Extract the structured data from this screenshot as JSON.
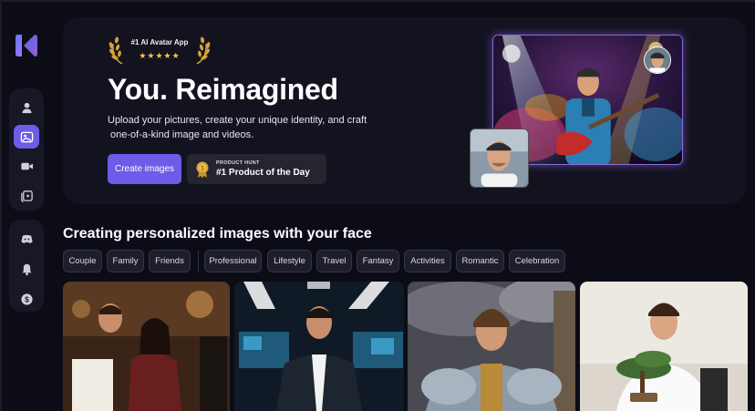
{
  "sidebar": {
    "logo": "app-logo",
    "group1": [
      {
        "icon": "user-icon",
        "active": false
      },
      {
        "icon": "face-image-icon",
        "active": true
      },
      {
        "icon": "video-camera-icon",
        "active": false
      },
      {
        "icon": "video-library-icon",
        "active": false
      }
    ],
    "group2": [
      {
        "icon": "discord-icon"
      },
      {
        "icon": "bell-icon"
      },
      {
        "icon": "dollar-icon"
      }
    ]
  },
  "hero": {
    "award_title": "#1 AI Avatar App",
    "award_stars": "★★★★★",
    "title": "You. Reimagined",
    "subtitle_line1": "Upload your pictures, create your unique identity, and craft",
    "subtitle_line2": "one-of-a-kind image and videos.",
    "cta_label": "Create images",
    "product_hunt_small": "PRODUCT HUNT",
    "product_hunt_main": "#1 Product of the Day"
  },
  "section": {
    "title": "Creating personalized images with your face",
    "chips": [
      "Couple",
      "Family",
      "Friends",
      "Professional",
      "Lifestyle",
      "Travel",
      "Fantasy",
      "Activities",
      "Romantic",
      "Celebration"
    ]
  },
  "colors": {
    "accent": "#6c5ce7",
    "background": "#0c0c17",
    "card": "#131320",
    "star": "#f5c542"
  }
}
